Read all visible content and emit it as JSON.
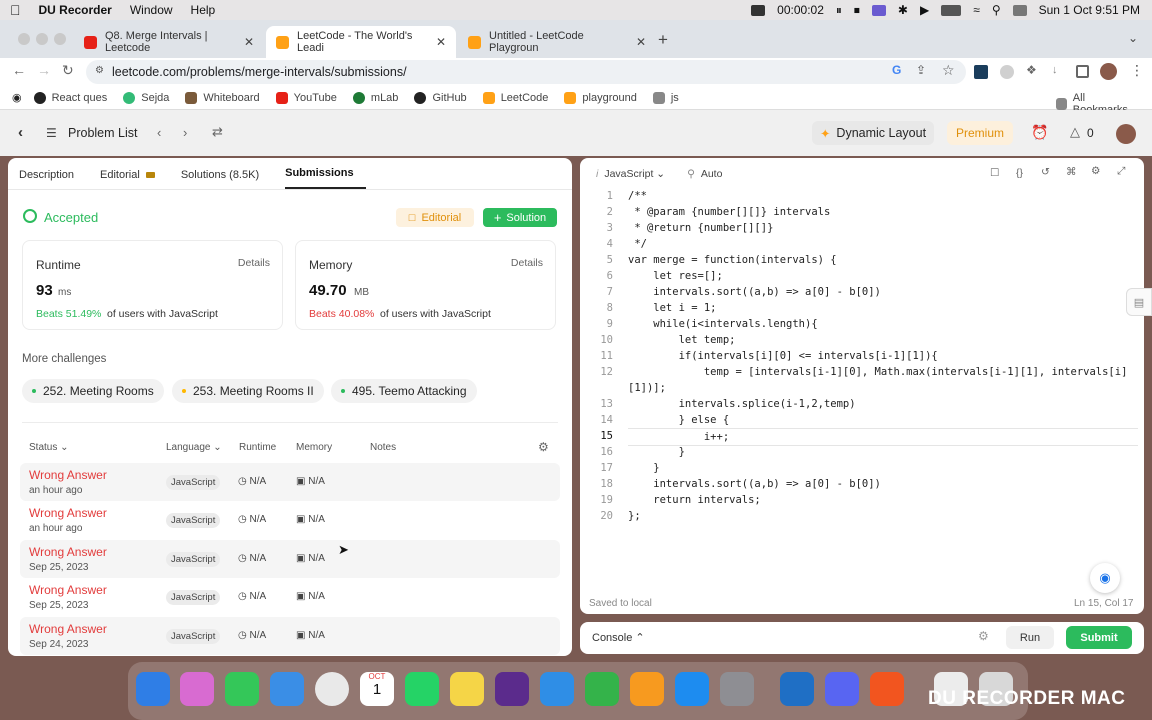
{
  "menubar": {
    "app": "DU Recorder",
    "items": [
      "Window",
      "Help"
    ],
    "timer": "00:00:02",
    "datetime": "Sun 1 Oct  9:51 PM"
  },
  "browser": {
    "tabs": [
      {
        "label": "Q8. Merge Intervals | Leetcode",
        "active": false
      },
      {
        "label": "LeetCode - The World's Leadi",
        "active": true
      },
      {
        "label": "Untitled - LeetCode Playgroun",
        "active": false
      }
    ],
    "new_tab": "+",
    "url": "leetcode.com/problems/merge-intervals/submissions/",
    "bookmarks": [
      "React ques",
      "Sejda",
      "Whiteboard",
      "YouTube",
      "mLab",
      "GitHub",
      "LeetCode",
      "playground",
      "js"
    ],
    "all_bookmarks": "All Bookmarks"
  },
  "lcnav": {
    "problem_list": "Problem List",
    "dynamic_layout": "Dynamic Layout",
    "premium": "Premium",
    "fire_count": "0"
  },
  "left": {
    "tabs": [
      "Description",
      "Editorial",
      "Solutions (8.5K)",
      "Submissions"
    ],
    "status": "Accepted",
    "editorial_btn": "Editorial",
    "solution_btn": "Solution",
    "runtime": {
      "label": "Runtime",
      "details": "Details",
      "value": "93",
      "unit": "ms",
      "beats": "Beats 51.49%",
      "suffix": "of users with JavaScript"
    },
    "memory": {
      "label": "Memory",
      "details": "Details",
      "value": "49.70",
      "unit": "MB",
      "beats": "Beats 40.08%",
      "suffix": "of users with JavaScript"
    },
    "more_challenges": "More challenges",
    "challenges": [
      {
        "label": "252. Meeting Rooms",
        "color": "#2cbb5d"
      },
      {
        "label": "253. Meeting Rooms II",
        "color": "#ffb800"
      },
      {
        "label": "495. Teemo Attacking",
        "color": "#2cbb5d"
      }
    ],
    "columns": [
      "Status",
      "Language",
      "Runtime",
      "Memory",
      "Notes"
    ],
    "rows": [
      {
        "status": "Wrong Answer",
        "time": "an hour ago",
        "lang": "JavaScript",
        "runtime": "N/A",
        "memory": "N/A"
      },
      {
        "status": "Wrong Answer",
        "time": "an hour ago",
        "lang": "JavaScript",
        "runtime": "N/A",
        "memory": "N/A"
      },
      {
        "status": "Wrong Answer",
        "time": "Sep 25, 2023",
        "lang": "JavaScript",
        "runtime": "N/A",
        "memory": "N/A"
      },
      {
        "status": "Wrong Answer",
        "time": "Sep 25, 2023",
        "lang": "JavaScript",
        "runtime": "N/A",
        "memory": "N/A"
      },
      {
        "status": "Wrong Answer",
        "time": "Sep 24, 2023",
        "lang": "JavaScript",
        "runtime": "N/A",
        "memory": "N/A"
      }
    ]
  },
  "editor": {
    "language": "JavaScript",
    "mode": "Auto",
    "lines": [
      "/**",
      " * @param {number[][]} intervals",
      " * @return {number[][]}",
      " */",
      "var merge = function(intervals) {",
      "    let res=[];",
      "    intervals.sort((a,b) => a[0] - b[0])",
      "    let i = 1;",
      "    while(i<intervals.length){",
      "        let temp;",
      "        if(intervals[i][0] <= intervals[i-1][1]){",
      "            temp = [intervals[i-1][0], Math.max(intervals[i-1][1], intervals[i]",
      "[1])];",
      "        intervals.splice(i-1,2,temp)",
      "        } else {",
      "            i++;",
      "        }",
      "    }",
      "    intervals.sort((a,b) => a[0] - b[0])",
      "    return intervals;",
      "};"
    ],
    "line_numbers": [
      "1",
      "2",
      "3",
      "4",
      "5",
      "6",
      "7",
      "8",
      "9",
      "10",
      "11",
      "12",
      "",
      "13",
      "14",
      "15",
      "16",
      "17",
      "18",
      "19",
      "20"
    ],
    "saved": "Saved to local",
    "cursor": "Ln 15, Col 17"
  },
  "console": {
    "label": "Console",
    "run": "Run",
    "submit": "Submit"
  },
  "dock": {
    "calendar_month": "OCT",
    "calendar_day": "1",
    "watermark": "DU RECORDER MAC"
  },
  "colors": {
    "accepted": "#2cbb5d",
    "wrong": "#e23c3c",
    "premium": "#ffa116"
  }
}
